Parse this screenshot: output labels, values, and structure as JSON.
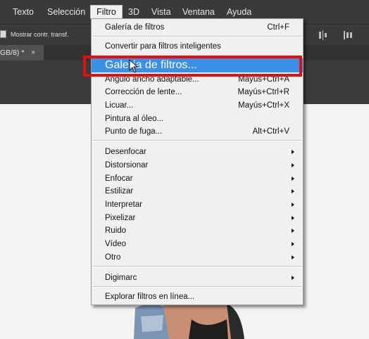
{
  "menubar": {
    "items": [
      "Texto",
      "Selección",
      "Filtro",
      "3D",
      "Vista",
      "Ventana",
      "Ayuda"
    ],
    "active": "Filtro"
  },
  "options_bar": {
    "show_transform_label": "Mostrar contr. transf."
  },
  "document_tab": {
    "label": "GB/8) *",
    "close": "×"
  },
  "filter_menu": {
    "items": [
      {
        "label": "Galería de filtros",
        "shortcut": "Ctrl+F"
      },
      {
        "label": "Convertir para filtros inteligentes",
        "shortcut": ""
      },
      {
        "label": "Galería de filtros...",
        "shortcut": ""
      },
      {
        "label": "Ángulo ancho adaptable...",
        "shortcut": "Mayús+Ctrl+A"
      },
      {
        "label": "Corrección de lente...",
        "shortcut": "Mayús+Ctrl+R"
      },
      {
        "label": "Licuar...",
        "shortcut": "Mayús+Ctrl+X"
      },
      {
        "label": "Pintura al óleo...",
        "shortcut": ""
      },
      {
        "label": "Punto de fuga...",
        "shortcut": "Alt+Ctrl+V"
      },
      {
        "label": "Desenfocar",
        "shortcut": ""
      },
      {
        "label": "Distorsionar",
        "shortcut": ""
      },
      {
        "label": "Enfocar",
        "shortcut": ""
      },
      {
        "label": "Estilizar",
        "shortcut": ""
      },
      {
        "label": "Interpretar",
        "shortcut": ""
      },
      {
        "label": "Pixelizar",
        "shortcut": ""
      },
      {
        "label": "Ruido",
        "shortcut": ""
      },
      {
        "label": "Vídeo",
        "shortcut": ""
      },
      {
        "label": "Otro",
        "shortcut": ""
      },
      {
        "label": "Digimarc",
        "shortcut": ""
      },
      {
        "label": "Explorar filtros en línea...",
        "shortcut": ""
      }
    ],
    "highlighted": "Galería de filtros..."
  },
  "colors": {
    "menubar_bg": "#3a3a3a",
    "menu_bg": "#f0f0f0",
    "highlight": "#3b8fe5",
    "annotation_red": "#e01010"
  }
}
